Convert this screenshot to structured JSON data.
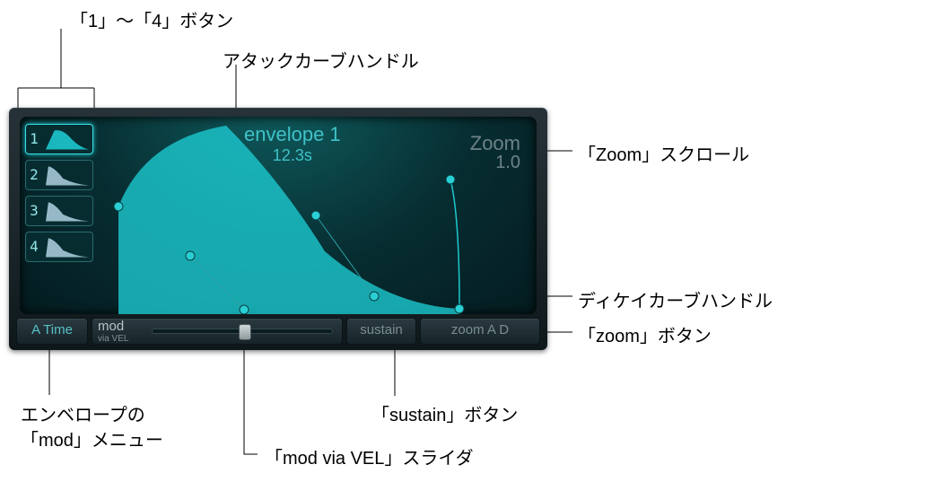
{
  "callouts": {
    "env_buttons": "「1」〜「4」ボタン",
    "attack_handle": "アタックカーブハンドル",
    "zoom_scroll": "「Zoom」スクロール",
    "decay_handle": "ディケイカーブハンドル",
    "zoom_button": "「zoom」ボタン",
    "sustain_button": "「sustain」ボタン",
    "mod_slider": "「mod via VEL」スライダ",
    "mod_menu_line1": "エンベロープの",
    "mod_menu_line2": "「mod」メニュー"
  },
  "env_buttons": [
    {
      "num": "1"
    },
    {
      "num": "2"
    },
    {
      "num": "3"
    },
    {
      "num": "4"
    }
  ],
  "envelope": {
    "title": "envelope 1",
    "time": "12.3s"
  },
  "zoom": {
    "label": "Zoom",
    "value": "1.0"
  },
  "bottom": {
    "atime": "A Time",
    "mod_label": "mod",
    "mod_sub": "via VEL",
    "sustain": "sustain",
    "zoom_ad": "zoom A D"
  }
}
